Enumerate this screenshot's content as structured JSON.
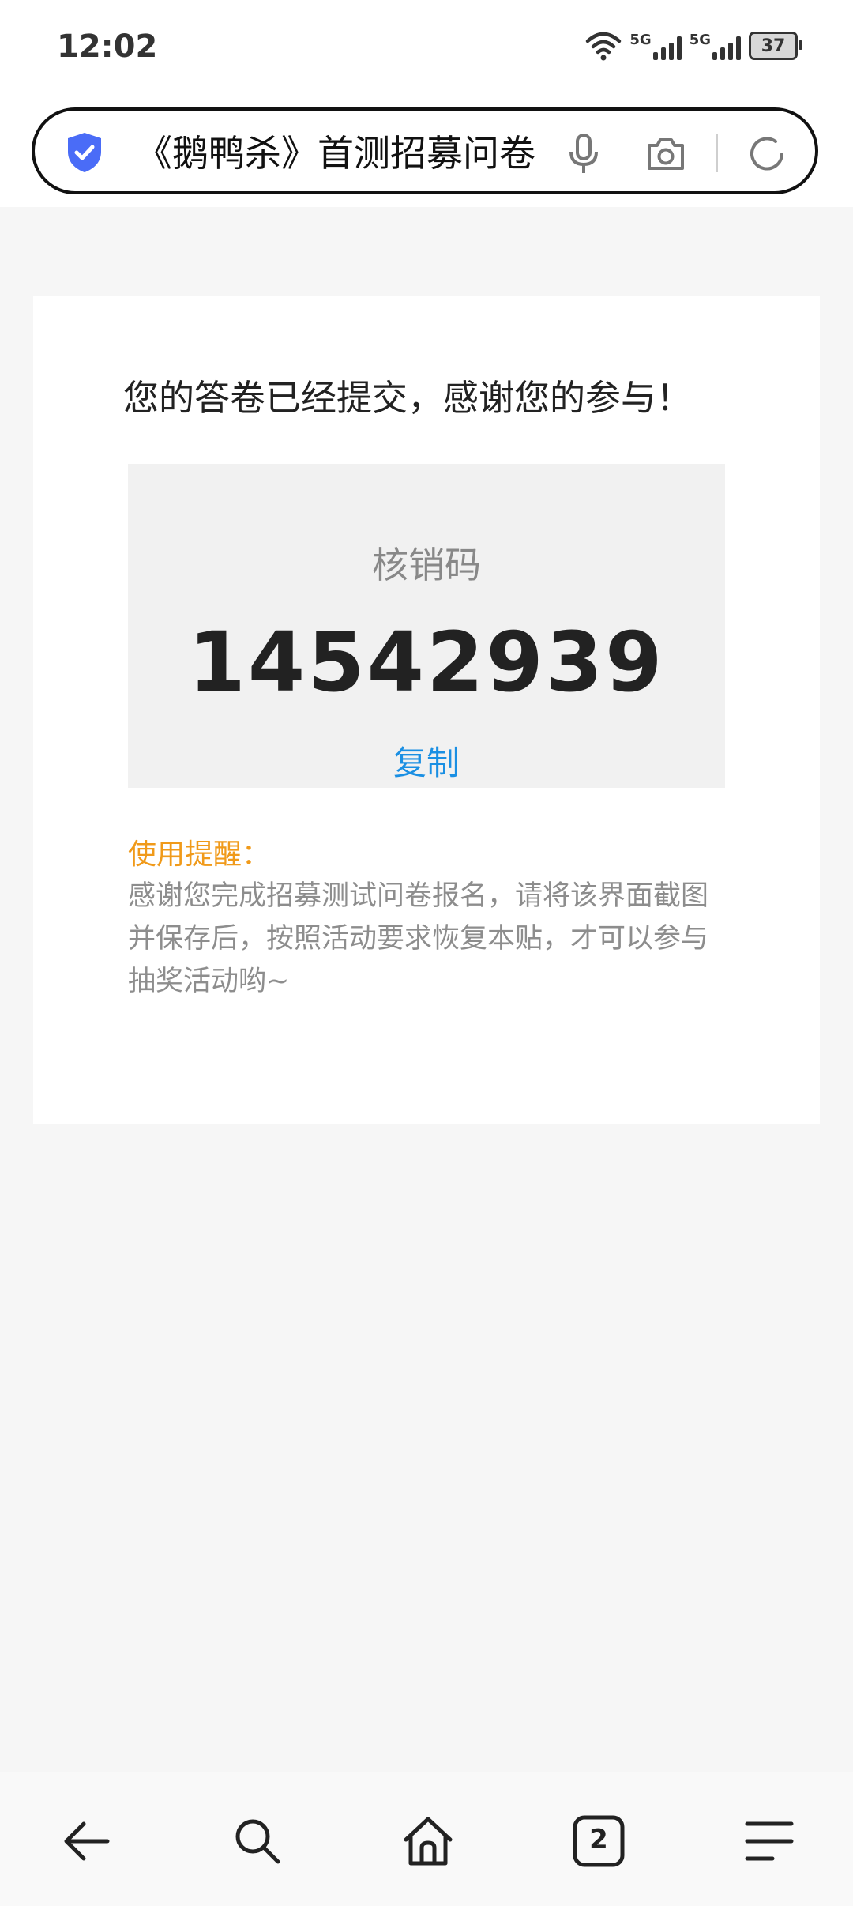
{
  "status_bar": {
    "time": "12:02",
    "network_1": "5G",
    "network_2": "5G",
    "battery": "37"
  },
  "address_bar": {
    "title": "《鹅鸭杀》首测招募问卷",
    "icons": [
      "shield-check-icon",
      "microphone-icon",
      "camera-icon",
      "refresh-icon"
    ]
  },
  "result": {
    "message": "您的答卷已经提交，感谢您的参与！",
    "code_label": "核销码",
    "code_value": "14542939",
    "copy_label": "复制",
    "tip_title": "使用提醒：",
    "tip_text": "感谢您完成招募测试问卷报名，请将该界面截图并保存后，按照活动要求恢复本贴，才可以参与抽奖活动哟~"
  },
  "bottom_nav": {
    "tabs_count": "2",
    "icons": [
      "back-arrow-icon",
      "search-icon",
      "home-icon",
      "tabs-icon",
      "menu-icon"
    ]
  },
  "colors": {
    "accent_blue": "#1a8fe3",
    "tip_orange": "#f09a1a",
    "shield_blue": "#4a6cf7"
  }
}
